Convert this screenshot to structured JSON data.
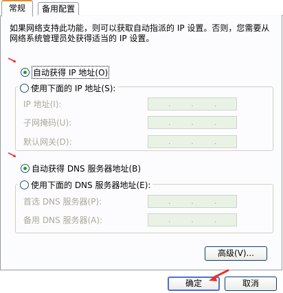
{
  "tabs": [
    {
      "label": "常规",
      "active": true
    },
    {
      "label": "备用配置",
      "active": false
    }
  ],
  "description": "如果网络支持此功能，则可以获取自动指派的 IP 设置。否则，您需要从网络系统管理员处获得适当的 IP 设置。",
  "ip_section": {
    "auto_option": {
      "label": "自动获得 IP 地址(O)",
      "checked": true
    },
    "manual_option": {
      "label": "使用下面的 IP 地址(S):",
      "checked": false
    },
    "fields": [
      {
        "label": "IP 地址(I):",
        "value": ". . ."
      },
      {
        "label": "子网掩码(U):",
        "value": ". . ."
      },
      {
        "label": "默认网关(D):",
        "value": ". . ."
      }
    ]
  },
  "dns_section": {
    "auto_option": {
      "label": "自动获得 DNS 服务器地址(B)",
      "checked": true
    },
    "manual_option": {
      "label": "使用下面的 DNS 服务器地址(E):",
      "checked": false
    },
    "fields": [
      {
        "label": "首选 DNS 服务器(P):",
        "value": ". . ."
      },
      {
        "label": "备用 DNS 服务器(A):",
        "value": ". . ."
      }
    ]
  },
  "buttons": {
    "advanced": "高级(V)...",
    "ok": "确定",
    "cancel": "取消"
  },
  "colors": {
    "annotation_arrow": "#e8332a",
    "radio_dot": "#21a121",
    "tab_highlight": "#e68b2c"
  }
}
